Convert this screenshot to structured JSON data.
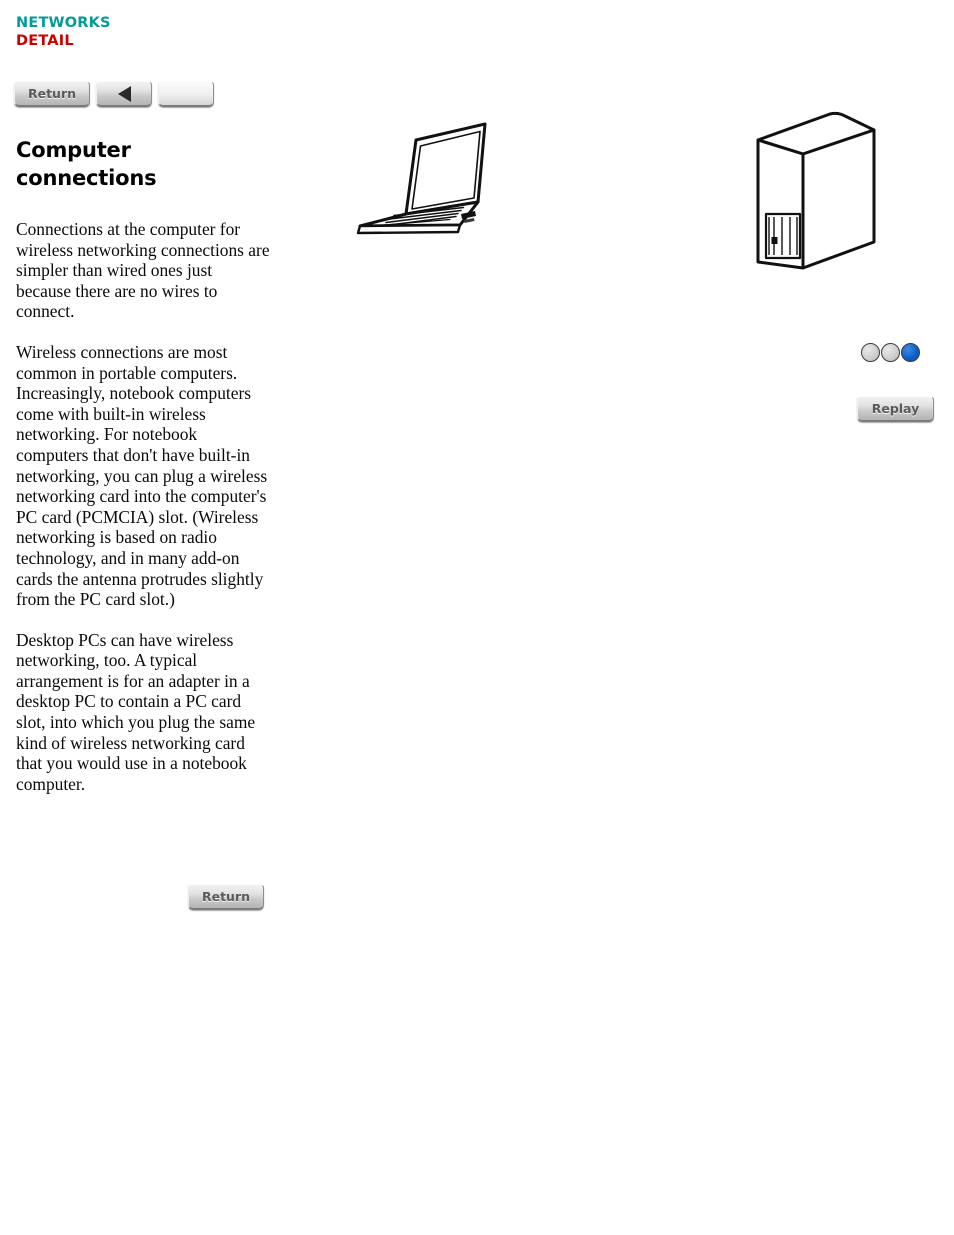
{
  "breadcrumb": {
    "line1": "NETWORKS",
    "line2": "DETAIL",
    "color_line1": "#049A9A",
    "color_line2": "#CC0000"
  },
  "topnav": {
    "return_label": "Return",
    "back_icon": "triangle-left-icon",
    "next_label": ""
  },
  "content": {
    "title": "Computer connections",
    "paragraphs": [
      "Connections at the computer for wireless networking connections are simpler than wired ones just because there are no wires to connect.",
      "Wireless connections are most common in portable computers. Increasingly, notebook computers come with built-in wireless networking. For notebook computers that don't have built-in networking, you can plug a wireless networking card into the computer's PC card (PCMCIA) slot. (Wireless networking is based on radio technology, and in many add-on cards the antenna protrudes slightly from the PC card slot.)",
      "Desktop PCs can have wireless networking, too. A typical arrangement is for an adapter in a desktop PC to contain a PC card slot, into which you plug the same kind of wireless networking card that you would use in a notebook computer."
    ],
    "return_label": "Return"
  },
  "illustrations": {
    "laptop": "notebook-computer-illustration",
    "tower": "desktop-tower-computer-illustration"
  },
  "player": {
    "dots": [
      {
        "name": "step-dot-1",
        "state": "inactive"
      },
      {
        "name": "step-dot-2",
        "state": "inactive"
      },
      {
        "name": "step-dot-3",
        "state": "active"
      }
    ],
    "active_dot_color": "#0F5FC8",
    "inactive_dot_color": "#CFCFCF",
    "replay_label": "Replay"
  }
}
